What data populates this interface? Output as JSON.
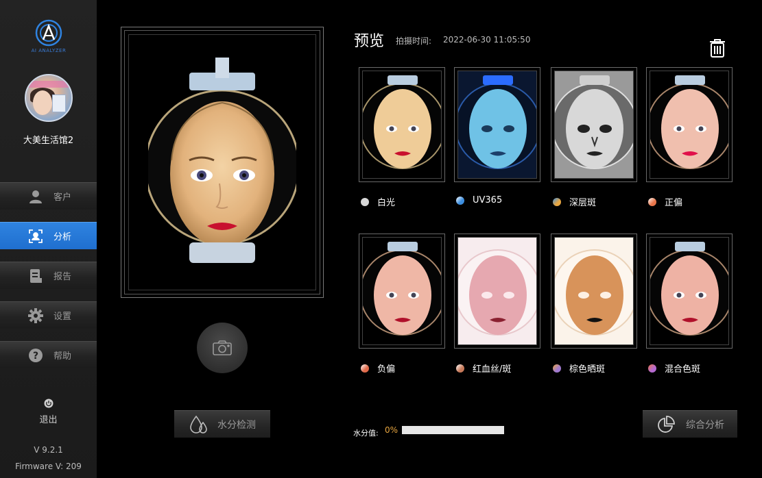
{
  "brand": {
    "logo_text": "AI ANALYZER",
    "accent": "#2f83e0"
  },
  "sidebar": {
    "shop_name": "大美生活馆2",
    "items": [
      {
        "label": "客户",
        "icon": "user-icon",
        "active": false
      },
      {
        "label": "分析",
        "icon": "face-scan-icon",
        "active": true
      },
      {
        "label": "报告",
        "icon": "report-icon",
        "active": false
      },
      {
        "label": "设置",
        "icon": "gear-icon",
        "active": false
      },
      {
        "label": "帮助",
        "icon": "help-icon",
        "active": false
      }
    ],
    "logout": "退出",
    "version": "V 9.2.1",
    "firmware": "Firmware V: 209"
  },
  "header": {
    "title": "预览",
    "capture_label": "拍摄时间:",
    "capture_time": "2022-06-30 11:05:50"
  },
  "thumbnails": [
    {
      "label": "白光",
      "dot": "#d8d8d8"
    },
    {
      "label": "UV365",
      "dot": "#3d8fe0"
    },
    {
      "label": "深层斑",
      "dot": "#e8a640"
    },
    {
      "label": "正偏",
      "dot": "#e8754a"
    },
    {
      "label": "负偏",
      "dot": "#e06a4a"
    },
    {
      "label": "红血丝/斑",
      "dot": "#c87a5a"
    },
    {
      "label": "棕色晒斑",
      "dot": "#a07ad0"
    },
    {
      "label": "混合色斑",
      "dot": "#b46ad0"
    }
  ],
  "water_button": "水分检测",
  "moisture": {
    "label": "水分值:",
    "value": "0%",
    "fraction": 0
  },
  "analyze_button": "综合分析"
}
